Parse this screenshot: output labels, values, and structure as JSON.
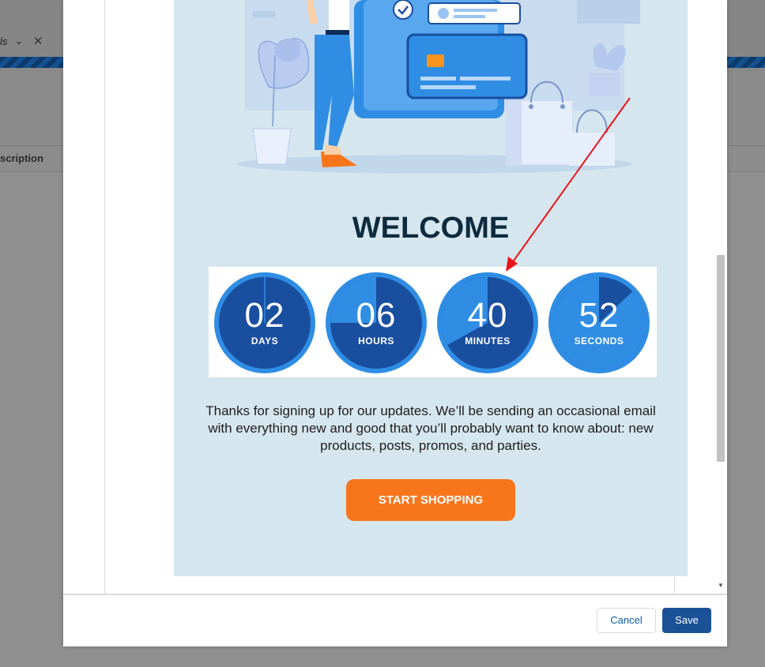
{
  "background": {
    "tab_label": "ls",
    "column_label": "scription"
  },
  "email": {
    "heading": "WELCOME",
    "countdown": [
      {
        "value": "02",
        "label": "DAYS",
        "fraction_elapsed": 0.0
      },
      {
        "value": "06",
        "label": "HOURS",
        "fraction_elapsed": 0.25
      },
      {
        "value": "40",
        "label": "MINUTES",
        "fraction_elapsed": 0.33
      },
      {
        "value": "52",
        "label": "SECONDS",
        "fraction_elapsed": 0.87
      }
    ],
    "body_text": "Thanks for signing up for our updates. We’ll be sending an occasional email with everything new and good that you’ll probably want to know about: new products, posts, promos, and parties.",
    "cta_label": "START SHOPPING"
  },
  "footer": {
    "cancel_label": "Cancel",
    "save_label": "Save"
  },
  "colors": {
    "email_bg": "#d6e6ee",
    "timer_dark": "#1a4fa0",
    "timer_light": "#2f8de4",
    "cta": "#f7761c",
    "save": "#1b5297",
    "arrow": "#e8141a"
  }
}
